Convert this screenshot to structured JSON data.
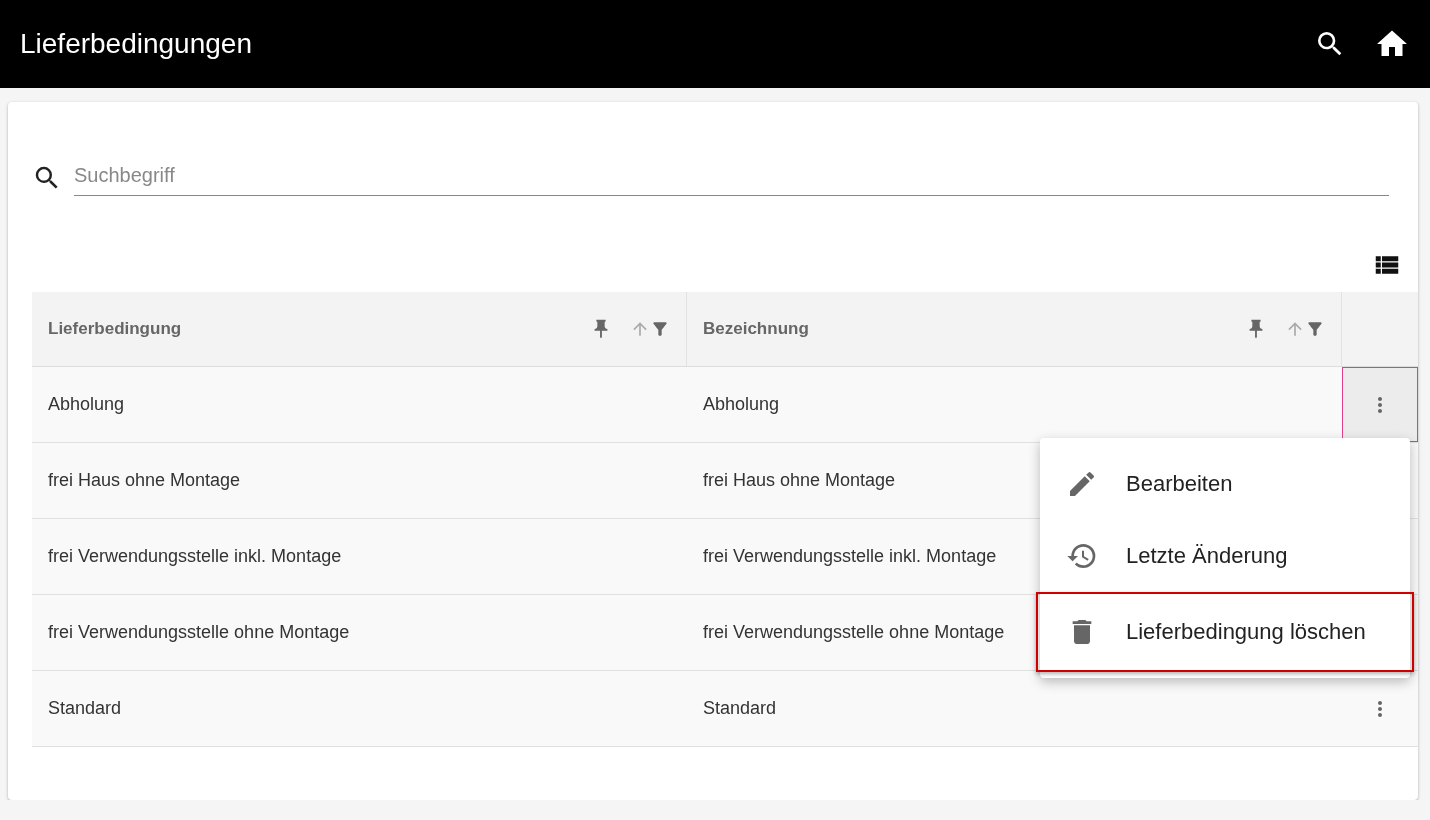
{
  "app_bar": {
    "title": "Lieferbedingungen"
  },
  "search": {
    "placeholder": "Suchbegriff"
  },
  "table": {
    "columns": [
      {
        "label": "Lieferbedingung"
      },
      {
        "label": "Bezeichnung"
      }
    ],
    "rows": [
      {
        "cells": [
          "Abholung",
          "Abholung"
        ],
        "menu_button": true,
        "active": true
      },
      {
        "cells": [
          "frei Haus ohne Montage",
          "frei Haus ohne Montage"
        ]
      },
      {
        "cells": [
          "frei Verwendungsstelle inkl. Montage",
          "frei Verwendungsstelle inkl. Montage"
        ]
      },
      {
        "cells": [
          "frei Verwendungsstelle ohne Montage",
          "frei Verwendungsstelle ohne Montage"
        ]
      },
      {
        "cells": [
          "Standard",
          "Standard"
        ],
        "menu_button": true,
        "active": false
      }
    ]
  },
  "context_menu": {
    "items": [
      {
        "kind": "edit",
        "label": "Bearbeiten",
        "highlighted": false
      },
      {
        "kind": "history",
        "label": "Letzte Änderung",
        "highlighted": false
      },
      {
        "kind": "delete",
        "label": "Lieferbedingung löschen",
        "highlighted": true
      }
    ]
  }
}
